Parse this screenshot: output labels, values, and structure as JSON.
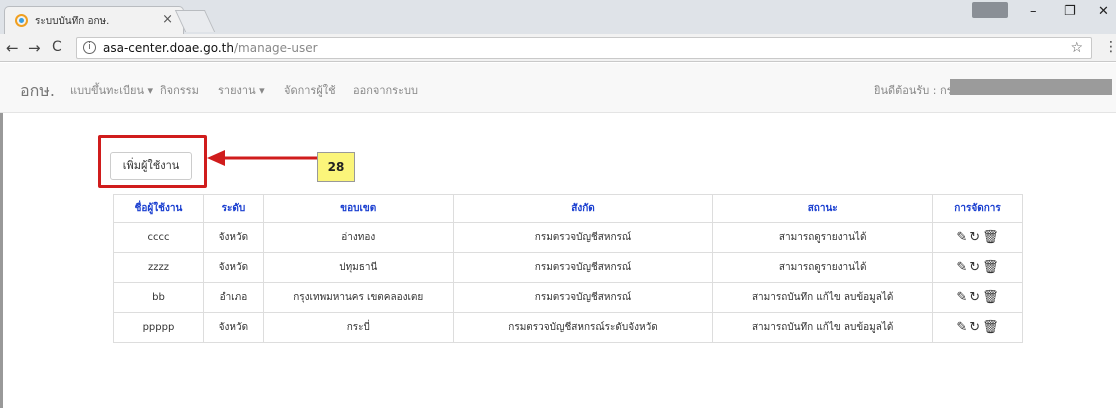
{
  "browser": {
    "tab_title": "ระบบบันทึก อกษ.",
    "tab_close": "×",
    "url_host": "asa-center.doae.go.th",
    "url_path": "/manage-user",
    "back": "←",
    "forward": "→",
    "reload": "C",
    "info": "i",
    "star": "☆",
    "menu": "⋮",
    "minimize": "–",
    "restore": "❐",
    "close": "✕"
  },
  "navbar": {
    "brand": "อกษ.",
    "items": [
      {
        "label": "แบบขึ้นทะเบียน ▾"
      },
      {
        "label": "กิจกรรม"
      },
      {
        "label": "รายงาน ▾"
      },
      {
        "label": "จัดการผู้ใช้"
      },
      {
        "label": "ออกจากระบบ"
      }
    ],
    "welcome": "ยินดีต้อนรับ : กรม"
  },
  "add_user_label": "เพิ่มผู้ใช้งาน",
  "callout_number": "28",
  "table": {
    "headers": [
      "ชื่อผู้ใช้งาน",
      "ระดับ",
      "ขอบเขต",
      "สังกัด",
      "สถานะ",
      "การจัดการ"
    ],
    "rows": [
      [
        "cccc",
        "จังหวัด",
        "อ่างทอง",
        "กรมตรวจบัญชีสหกรณ์",
        "สามารถดูรายงานได้"
      ],
      [
        "zzzz",
        "จังหวัด",
        "ปทุมธานี",
        "กรมตรวจบัญชีสหกรณ์",
        "สามารถดูรายงานได้"
      ],
      [
        "bb",
        "อำเภอ",
        "กรุงเทพมหานคร เขตคลองเตย",
        "กรมตรวจบัญชีสหกรณ์",
        "สามารถบันทึก แก้ไข ลบข้อมูลได้"
      ],
      [
        "ppppp",
        "จังหวัด",
        "กระบี่",
        "กรมตรวจบัญชีสหกรณ์ระดับจังหวัด",
        "สามารถบันทึก แก้ไข ลบข้อมูลได้"
      ]
    ]
  },
  "icons": {
    "edit": "✎",
    "refresh": "↻",
    "delete": "🗑"
  },
  "colors": {
    "header_text": "#1a3fd0",
    "highlight_red": "#d01c1c",
    "callout_yellow": "#fbf57a"
  }
}
